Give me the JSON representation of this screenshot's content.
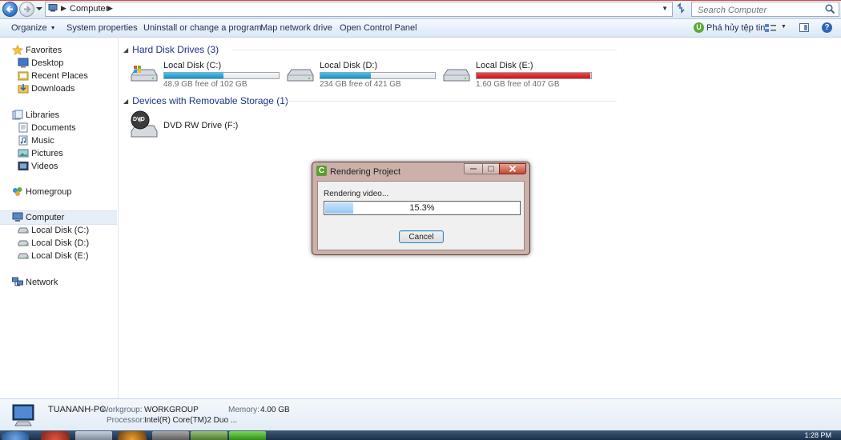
{
  "address_bar": {
    "breadcrumb": "Computer",
    "search_placeholder": "Search Computer"
  },
  "command_bar": {
    "organize": "Organize",
    "system_properties": "System properties",
    "uninstall": "Uninstall or change a program",
    "map_network_drive": "Map network drive",
    "open_control_panel": "Open Control Panel",
    "right_action": "Phá hủy tệp tin",
    "right_action_icon_letter": "U"
  },
  "nav_pane": {
    "favorites": "Favorites",
    "desktop": "Desktop",
    "recent_places": "Recent Places",
    "downloads": "Downloads",
    "libraries": "Libraries",
    "documents": "Documents",
    "music": "Music",
    "pictures": "Pictures",
    "videos": "Videos",
    "homegroup": "Homegroup",
    "computer": "Computer",
    "disk_c": "Local Disk (C:)",
    "disk_d": "Local Disk (D:)",
    "disk_e": "Local Disk (E:)",
    "network": "Network"
  },
  "content": {
    "hard_disk_header": "Hard Disk Drives (3)",
    "removable_header": "Devices with Removable Storage (1)",
    "drives": [
      {
        "name": "Local Disk (C:)",
        "free_text": "48.9 GB free of 102 GB",
        "used_fraction": 0.52,
        "status": "normal"
      },
      {
        "name": "Local Disk (D:)",
        "free_text": "234 GB free of 421 GB",
        "used_fraction": 0.44,
        "status": "normal"
      },
      {
        "name": "Local Disk (E:)",
        "free_text": "1.60 GB free of 407 GB",
        "used_fraction": 0.996,
        "status": "low"
      }
    ],
    "dvd": {
      "name": "DVD RW Drive (F:)",
      "icon_text": "DVD"
    }
  },
  "details_pane": {
    "pc_name": "TUANANH-PC",
    "workgroup_key": "Workgroup:",
    "workgroup_val": "WORKGROUP",
    "memory_key": "Memory:",
    "memory_val": "4.00 GB",
    "processor_key": "Processor:",
    "processor_val": "Intel(R) Core(TM)2 Duo ..."
  },
  "taskbar": {
    "clock": "1:28 PM"
  },
  "dialog": {
    "title": "Rendering Project",
    "app_icon_letter": "C",
    "status": "Rendering video...",
    "progress_text": "15.3%",
    "progress_fraction": 0.153,
    "cancel_label": "Cancel"
  },
  "colors": {
    "drive_bar_normal": "#1a8fc6",
    "drive_bar_low": "#c81414",
    "progress_fill": "#96c6ee",
    "header_text": "#1e3287"
  }
}
